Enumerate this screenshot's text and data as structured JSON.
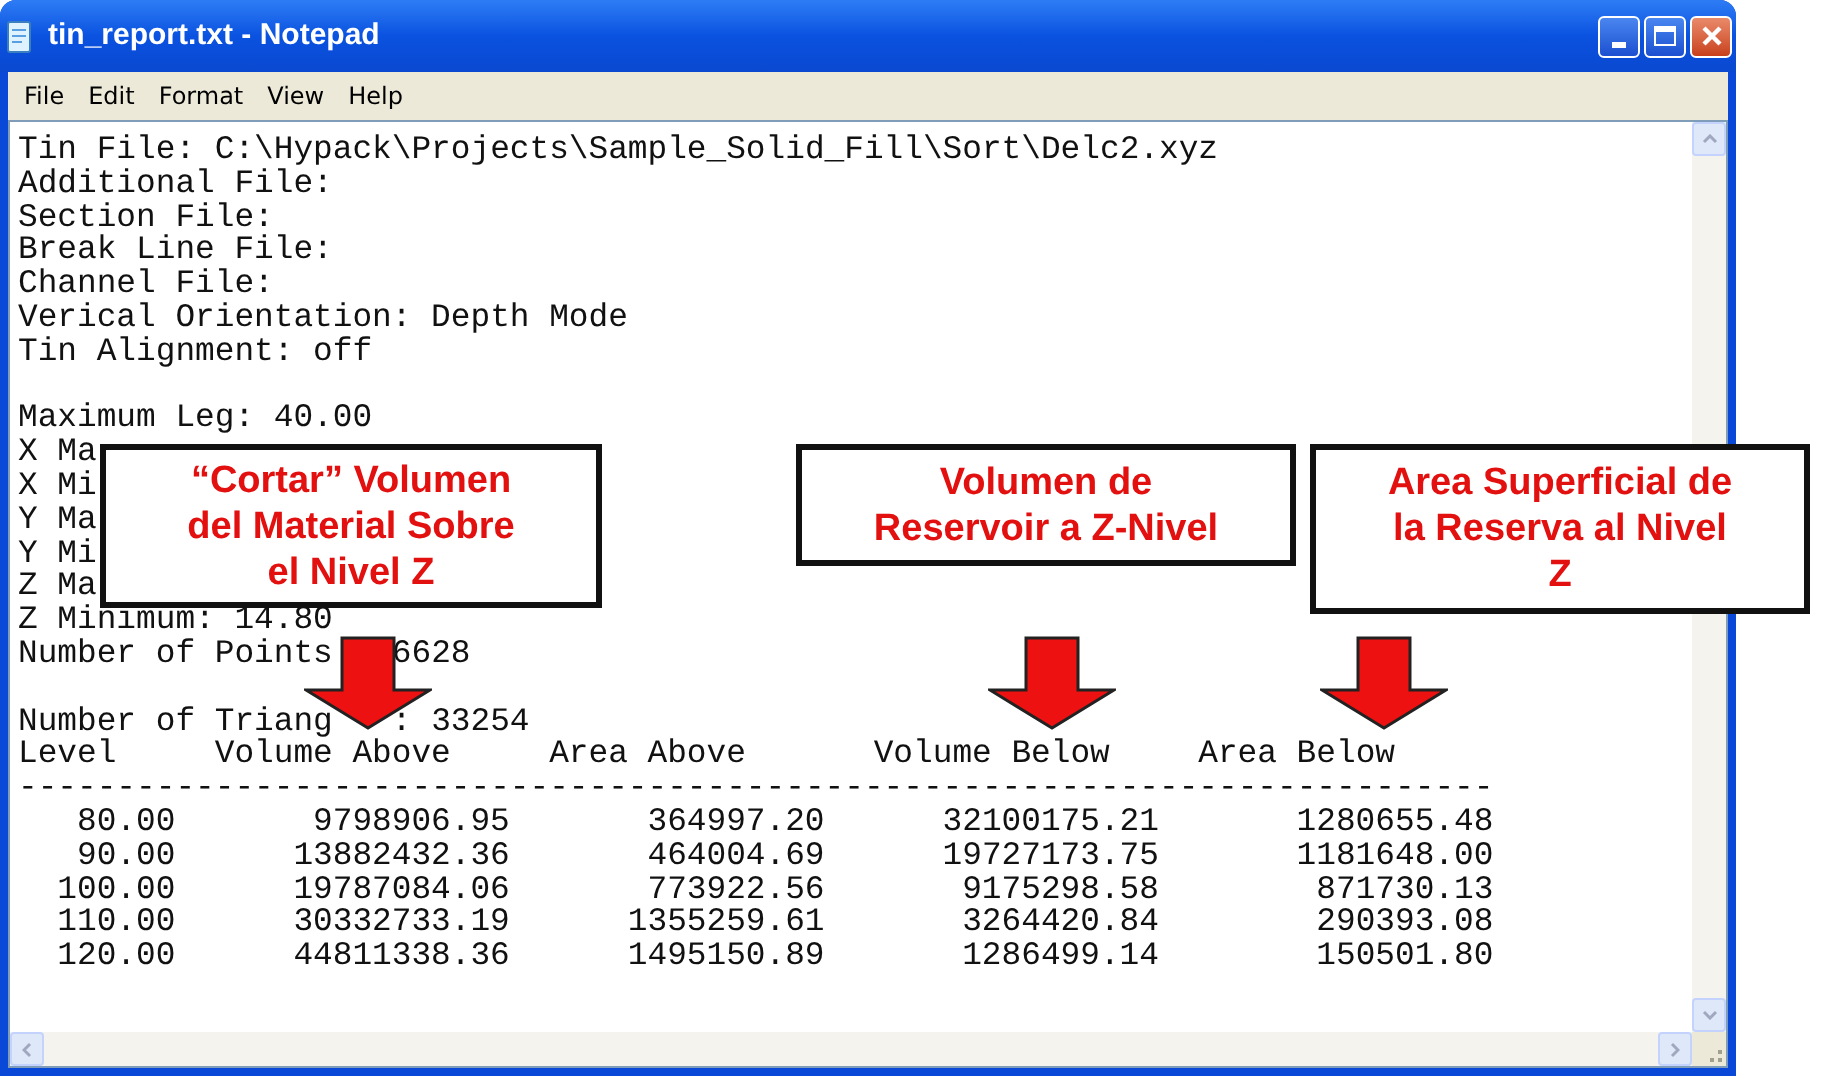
{
  "window": {
    "title": "tin_report.txt - Notepad",
    "buttons": [
      {
        "kind": "minimize"
      },
      {
        "kind": "maximize"
      },
      {
        "kind": "close"
      }
    ]
  },
  "menu": [
    {
      "label": "File"
    },
    {
      "label": "Edit"
    },
    {
      "label": "Format"
    },
    {
      "label": "View"
    },
    {
      "label": "Help"
    }
  ],
  "document": {
    "header_lines": [
      "Tin File: C:\\Hypack\\Projects\\Sample_Solid_Fill\\Sort\\Delc2.xyz",
      "Additional File:",
      "Section File:",
      "Break Line File:",
      "Channel File:",
      "Verical Orientation: Depth Mode",
      "Tin Alignment: off"
    ],
    "stats_lines": [
      "Maximum Leg: 40.00",
      "X Ma",
      "X Mi",
      "Y Ma",
      "Y Mi",
      "Z Ma",
      "Z Minimum: 14.80"
    ],
    "points_line": [
      "Number of Points",
      "6628"
    ],
    "triangles_line": [
      "Number of Triang",
      ": 33254"
    ],
    "table": {
      "columns": [
        "Level",
        "Volume Above",
        "Area Above",
        "Volume Below",
        "Area Below"
      ],
      "separator": "---------------------------------------------------------------------------",
      "rows": [
        [
          "80.00",
          "9798906.95",
          "364997.20",
          "32100175.21",
          "1280655.48"
        ],
        [
          "90.00",
          "13882432.36",
          "464004.69",
          "19727173.75",
          "1181648.00"
        ],
        [
          "100.00",
          "19787084.06",
          "773922.56",
          "9175298.58",
          "871730.13"
        ],
        [
          "110.00",
          "30332733.19",
          "1355259.61",
          "3264420.84",
          "290393.08"
        ],
        [
          "120.00",
          "44811338.36",
          "1495150.89",
          "1286499.14",
          "150501.80"
        ]
      ]
    }
  },
  "callouts": [
    {
      "text": "“Cortar” Volumen\ndel Material Sobre\nel Nivel Z"
    },
    {
      "text": "Volumen de\nReservoir a Z-Nivel"
    },
    {
      "text": "Area Superficial de\nla Reserva al Nivel\nZ"
    }
  ]
}
